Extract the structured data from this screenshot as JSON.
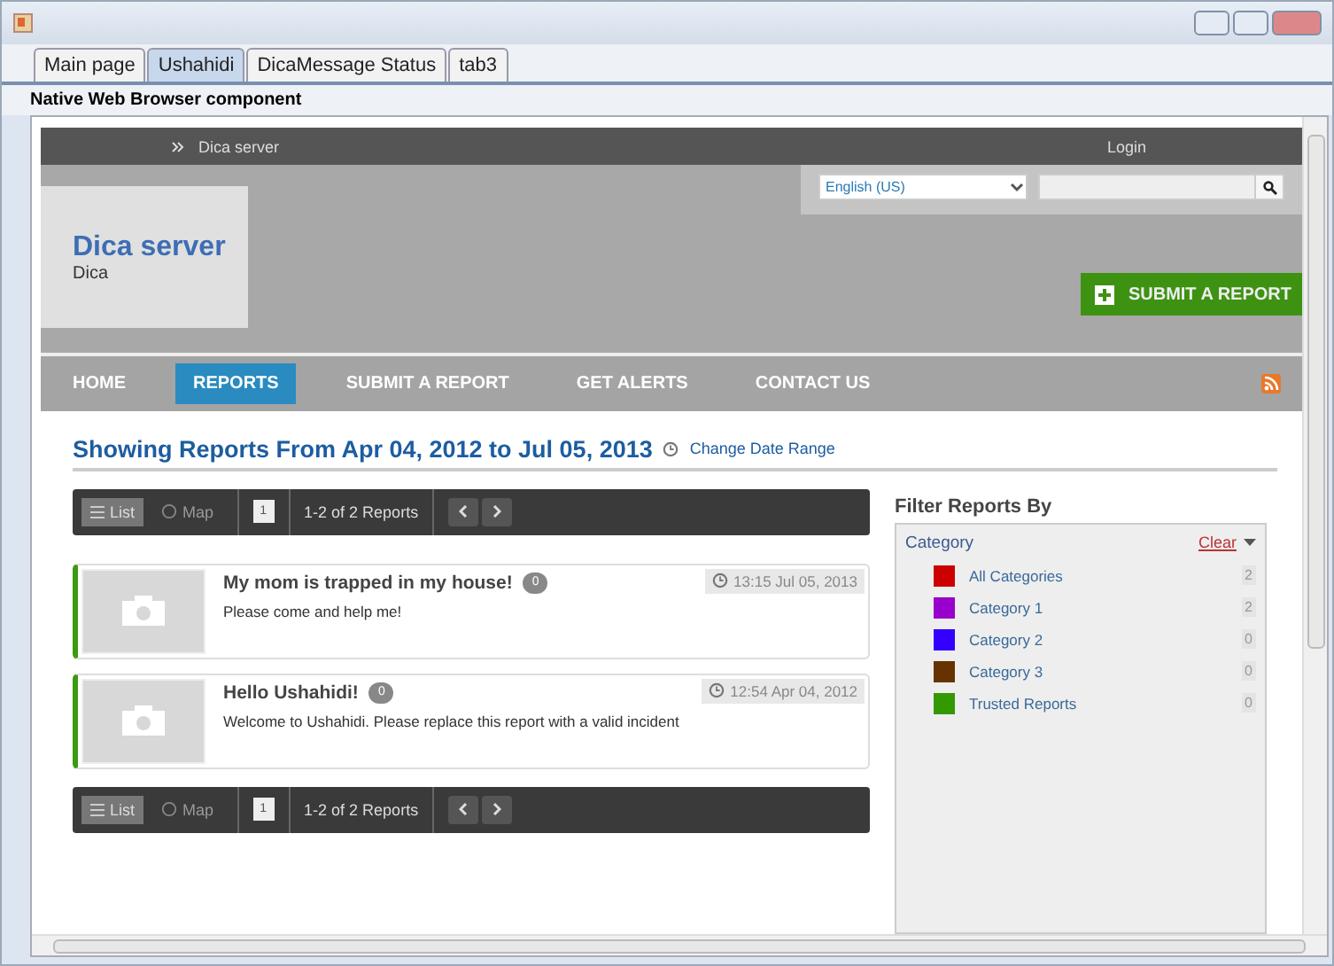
{
  "tabs": [
    {
      "label": "Main page",
      "selected": false
    },
    {
      "label": "Ushahidi",
      "selected": true
    },
    {
      "label": "DicaMessage Status",
      "selected": false
    },
    {
      "label": "tab3",
      "selected": false
    }
  ],
  "panel_label": "Native Web Browser component",
  "top_bar": {
    "breadcrumb": "Dica server",
    "login": "Login"
  },
  "site": {
    "title": "Dica server",
    "subtitle": "Dica",
    "language": "English (US)",
    "submit_button": "SUBMIT A REPORT"
  },
  "nav": [
    {
      "label": "HOME",
      "selected": false
    },
    {
      "label": "REPORTS",
      "selected": true
    },
    {
      "label": "SUBMIT A REPORT",
      "selected": false
    },
    {
      "label": "GET ALERTS",
      "selected": false
    },
    {
      "label": "CONTACT US",
      "selected": false
    }
  ],
  "heading": "Showing Reports From Apr 04, 2012 to Jul 05, 2013",
  "change_date": "Change Date Range",
  "toolbars": [
    {
      "views": [
        {
          "label": "List",
          "selected": true
        },
        {
          "label": "Map",
          "selected": false
        }
      ],
      "page": "1",
      "count": "1-2 of 2 Reports"
    },
    {
      "views": [
        {
          "label": "List",
          "selected": true
        },
        {
          "label": "Map",
          "selected": false
        }
      ],
      "page": "1",
      "count": "1-2 of 2 Reports"
    }
  ],
  "reports": [
    {
      "title": "My mom is trapped in my house!",
      "comments": "0",
      "time": "13:15 Jul 05, 2013",
      "body": "Please come and help me!"
    },
    {
      "title": "Hello Ushahidi!",
      "comments": "0",
      "time": "12:54 Apr 04, 2012",
      "body": "Welcome to Ushahidi. Please replace this report with a valid incident"
    }
  ],
  "filter": {
    "title": "Filter Reports By",
    "section": "Category",
    "clear": "Clear",
    "categories": [
      {
        "label": "All Categories",
        "color": "#cc0000",
        "count": "2"
      },
      {
        "label": "Category 1",
        "color": "#9900cc",
        "count": "2"
      },
      {
        "label": "Category 2",
        "color": "#3300ff",
        "count": "0"
      },
      {
        "label": "Category 3",
        "color": "#663300",
        "count": "0"
      },
      {
        "label": "Trusted Reports",
        "color": "#339900",
        "count": "0"
      }
    ]
  }
}
